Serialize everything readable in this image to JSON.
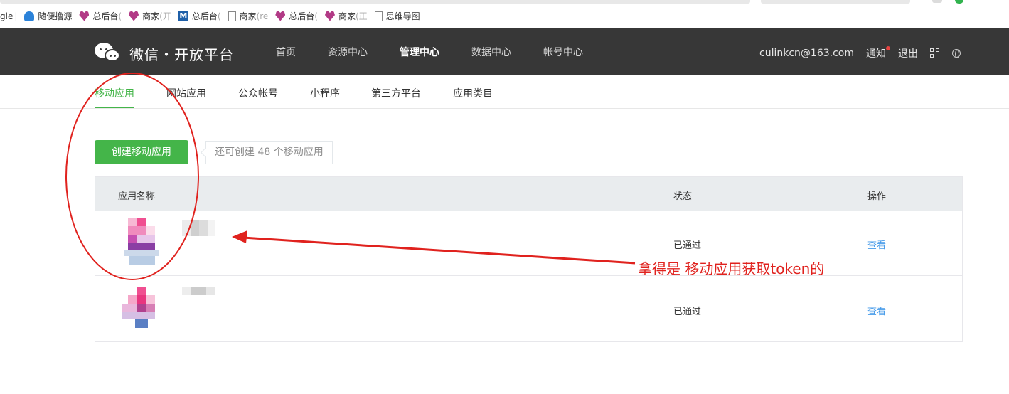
{
  "bookmarks": [
    {
      "label": "gle",
      "icon": "none",
      "faded": false
    },
    {
      "label": "随便撸源",
      "icon": "cloud-icon",
      "faded": false
    },
    {
      "label": "总后台",
      "icon": "shop-heart-icon",
      "faded": false,
      "trail": "("
    },
    {
      "label": "商家",
      "icon": "shop-heart-icon",
      "faded": false,
      "trail": "(开"
    },
    {
      "label": "总后台",
      "icon": "m-logo-icon",
      "faded": false,
      "trail": "("
    },
    {
      "label": "商家",
      "icon": "page-icon",
      "faded": false,
      "trail": "(re"
    },
    {
      "label": "总后台",
      "icon": "shop-heart-icon",
      "faded": false,
      "trail": "("
    },
    {
      "label": "商家",
      "icon": "shop-heart-icon",
      "faded": false,
      "trail": "(正"
    },
    {
      "label": "思维导图",
      "icon": "page-icon",
      "faded": false
    }
  ],
  "header": {
    "logo_text": "微信・开放平台",
    "nav": [
      "首页",
      "资源中心",
      "管理中心",
      "数据中心",
      "帐号中心"
    ],
    "active_nav": "管理中心",
    "account": "culinkcn@163.com",
    "notify": "通知",
    "logout": "退出"
  },
  "subtabs": {
    "items": [
      "移动应用",
      "网站应用",
      "公众帐号",
      "小程序",
      "第三方平台",
      "应用类目"
    ],
    "active": "移动应用"
  },
  "create": {
    "button": "创建移动应用",
    "quota": "还可创建 48 个移动应用"
  },
  "table": {
    "headers": {
      "name": "应用名称",
      "status": "状态",
      "action": "操作"
    },
    "rows": [
      {
        "status": "已通过",
        "action": "查看"
      },
      {
        "status": "已通过",
        "action": "查看"
      }
    ]
  },
  "annotation": {
    "text": "拿得是 移动应用获取token的"
  },
  "colors": {
    "header_bg": "#373737",
    "accent_green": "#44b549",
    "link_blue": "#459ae9",
    "annotation_red": "#e0221e"
  }
}
